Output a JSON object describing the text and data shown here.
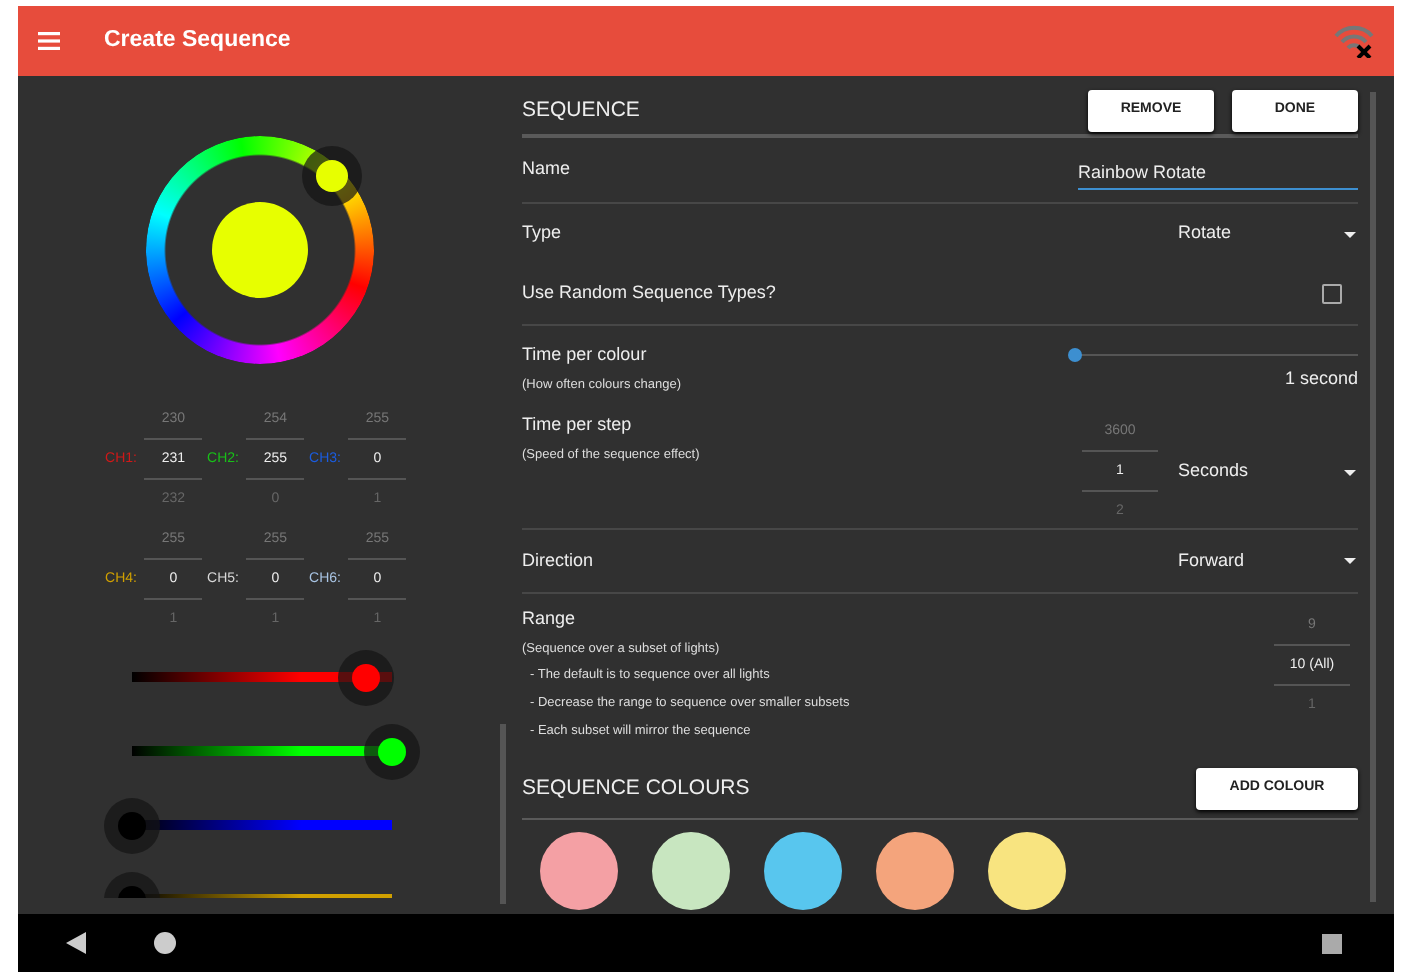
{
  "app_bar": {
    "title": "Create Sequence"
  },
  "channels": [
    {
      "label": "CH1:",
      "color": "#d01818",
      "above": "230",
      "value": "231",
      "below": "232"
    },
    {
      "label": "CH2:",
      "color": "#18c018",
      "above": "254",
      "value": "255",
      "below": "0"
    },
    {
      "label": "CH3:",
      "color": "#1a5ce0",
      "above": "255",
      "value": "0",
      "below": "1"
    },
    {
      "label": "CH4:",
      "color": "#d0a000",
      "above": "255",
      "value": "0",
      "below": "1"
    },
    {
      "label": "CH5:",
      "color": "#d8d8d8",
      "above": "255",
      "value": "0",
      "below": "1"
    },
    {
      "label": "CH6:",
      "color": "#a8c4e4",
      "above": "255",
      "value": "0",
      "below": "1"
    }
  ],
  "sliders": [
    {
      "color": "#ff0000",
      "level": 0.9
    },
    {
      "color": "#00ff00",
      "level": 1
    },
    {
      "color": "#0000ff",
      "level": 0
    },
    {
      "color": "#d0a000",
      "level": 0
    }
  ],
  "sequence": {
    "title": "SEQUENCE",
    "buttons": [
      "REMOVE",
      "DONE"
    ],
    "rows": [
      {
        "kind": "text",
        "label": "Name",
        "value": "Rainbow Rotate",
        "divider": false
      },
      {
        "kind": "dropdown",
        "label": "Type",
        "value": "Rotate",
        "divider": true
      },
      {
        "kind": "checkbox",
        "label": "Use Random Sequence Types?",
        "checked": false,
        "divider": false
      },
      {
        "kind": "slider",
        "label": "Time per colour",
        "hint": "(How often colours change)",
        "level": 0,
        "reading": "1 second",
        "divider": true
      },
      {
        "kind": "picker",
        "label": "Time per step",
        "hint": "(Speed of the sequence effect)",
        "above": "3600",
        "value": "1",
        "below": "2",
        "unit": "Seconds",
        "divider": false
      },
      {
        "kind": "dropdown",
        "label": "Direction",
        "value": "Forward",
        "divider": true
      },
      {
        "kind": "picker",
        "label": "Range",
        "hint": "(Sequence over a subset of lights)",
        "notes": [
          "- The default is to sequence over all lights",
          "- Decrease the range to sequence over smaller subsets",
          "- Each subset will mirror the sequence"
        ],
        "above": "9",
        "value": "10 (All)",
        "below": "1",
        "divider": true
      }
    ]
  },
  "colours": {
    "title": "SEQUENCE COLOURS",
    "button": "ADD COLOUR",
    "swatches": [
      {
        "color": "#f4a0a4"
      },
      {
        "color": "#c8e6c0"
      },
      {
        "color": "#58c6ee"
      },
      {
        "color": "#f4a47c"
      },
      {
        "color": "#f8e480"
      }
    ]
  }
}
